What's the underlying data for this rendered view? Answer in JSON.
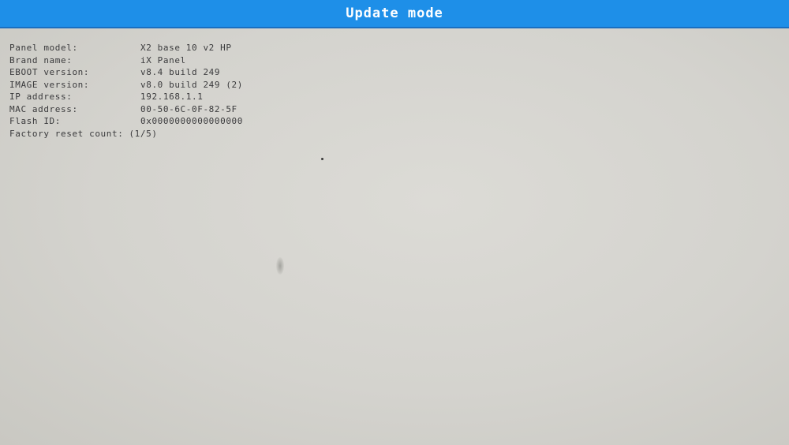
{
  "title": "Update mode",
  "colors": {
    "title_bar": "#1e8fe8",
    "screen_background": "#d3d2cc",
    "text": "#3a3a3c"
  },
  "info": [
    {
      "label": "Panel model:",
      "value": "X2 base 10 v2 HP"
    },
    {
      "label": "Brand name:",
      "value": "iX Panel"
    },
    {
      "label": "EBOOT version:",
      "value": "v8.4 build 249"
    },
    {
      "label": "IMAGE version:",
      "value": "v8.0 build 249 (2)"
    },
    {
      "label": "IP address:",
      "value": "192.168.1.1"
    },
    {
      "label": "MAC address:",
      "value": "00-50-6C-0F-82-5F"
    },
    {
      "label": "Flash ID:",
      "value": "0x0000000000000000"
    },
    {
      "label": "Factory reset count:",
      "value": "(1/5)"
    }
  ]
}
